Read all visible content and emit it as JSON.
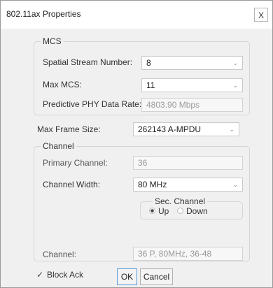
{
  "window": {
    "title": "802.11ax Properties",
    "close_label": "X"
  },
  "mcs": {
    "legend": "MCS",
    "spatial_stream_label": "Spatial Stream Number:",
    "spatial_stream_value": "8",
    "max_mcs_label": "Max MCS:",
    "max_mcs_value": "11",
    "phy_rate_label": "Predictive PHY Data Rate:",
    "phy_rate_value": "4803.90 Mbps"
  },
  "max_frame": {
    "label": "Max Frame Size:",
    "value": "262143 A-MPDU"
  },
  "channel": {
    "legend": "Channel",
    "primary_label": "Primary Channel:",
    "primary_value": "36",
    "width_label": "Channel Width:",
    "width_value": "80 MHz",
    "sec_legend": "Sec. Channel",
    "sec_up": "Up",
    "sec_down": "Down",
    "channel_label": "Channel:",
    "channel_value": "36 P, 80MHz, 36-48"
  },
  "block_ack": {
    "label": "Block Ack",
    "checked": true
  },
  "buttons": {
    "ok": "OK",
    "cancel": "Cancel"
  }
}
